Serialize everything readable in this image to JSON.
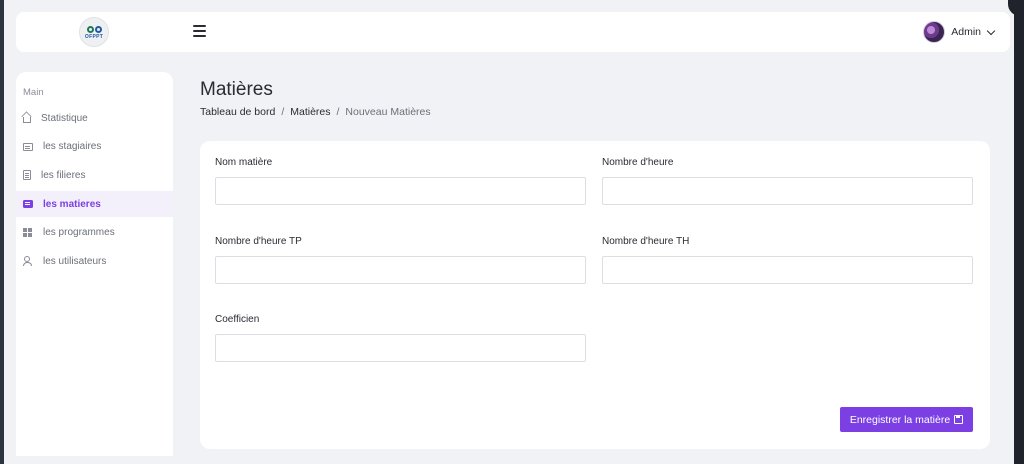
{
  "header": {
    "logo_text": "OFPPT",
    "menu_icon": "hamburger-menu-icon",
    "user_name": "Admin",
    "user_icon": "chevron-down-icon"
  },
  "sidebar": {
    "section_label": "Main",
    "items": [
      {
        "label": "Statistique",
        "icon": "home-icon",
        "active": false
      },
      {
        "label": "les stagiaires",
        "icon": "id-card-icon",
        "active": false
      },
      {
        "label": "les filieres",
        "icon": "document-icon",
        "active": false
      },
      {
        "label": "les matieres",
        "icon": "message-icon",
        "active": true
      },
      {
        "label": "les programmes",
        "icon": "grid-icon",
        "active": false
      },
      {
        "label": "les utilisateurs",
        "icon": "users-icon",
        "active": false
      }
    ]
  },
  "main": {
    "title": "Matières",
    "breadcrumb": {
      "home": "Tableau de bord",
      "section": "Matières",
      "current": "Nouveau Matières",
      "separator": "/"
    },
    "form": {
      "fields": [
        {
          "label": "Nom matière",
          "value": "",
          "placeholder": ""
        },
        {
          "label": "Nombre d'heure",
          "value": "",
          "placeholder": ""
        },
        {
          "label": "Nombre d'heure TP",
          "value": "",
          "placeholder": ""
        },
        {
          "label": "Nombre d'heure TH",
          "value": "",
          "placeholder": ""
        },
        {
          "label": "Coefficien",
          "value": "",
          "placeholder": ""
        }
      ],
      "submit_label": "Enregistrer la matière",
      "submit_icon": "save-icon"
    }
  },
  "colors": {
    "accent": "#7b3fe4",
    "background": "#f1f2f5",
    "surface": "#ffffff",
    "text": "#2b2b33",
    "muted": "#6b6f79"
  }
}
